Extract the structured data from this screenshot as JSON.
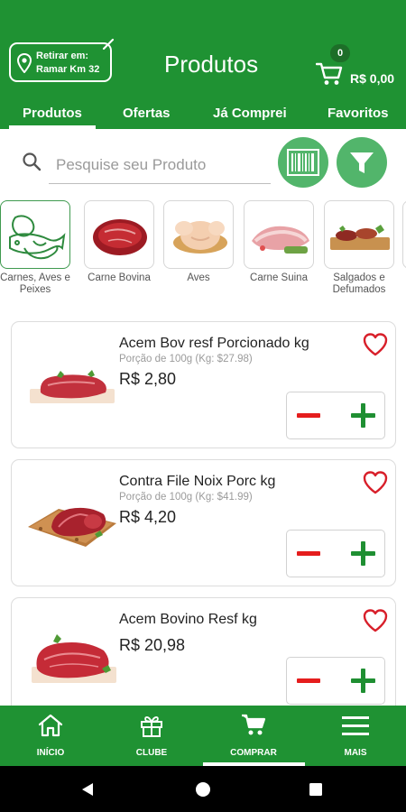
{
  "header": {
    "pickup_line1": "Retirar em:",
    "pickup_line2": "Ramar Km 32",
    "title": "Produtos",
    "cart_count": "0",
    "cart_total": "R$ 0,00"
  },
  "tabs": [
    {
      "label": "Produtos",
      "active": true
    },
    {
      "label": "Ofertas",
      "active": false
    },
    {
      "label": "Já Comprei",
      "active": false
    },
    {
      "label": "Favoritos",
      "active": false
    }
  ],
  "search": {
    "placeholder": "Pesquise seu Produto"
  },
  "categories": [
    {
      "label": "Carnes, Aves e Peixes",
      "selected": true
    },
    {
      "label": "Carne Bovina",
      "selected": false
    },
    {
      "label": "Aves",
      "selected": false
    },
    {
      "label": "Carne Suina",
      "selected": false
    },
    {
      "label": "Salgados e Defumados",
      "selected": false
    }
  ],
  "products": [
    {
      "name": "Acem Bov resf Porcionado kg",
      "portion": "Porção de 100g (Kg: $27.98)",
      "price": "R$ 2,80"
    },
    {
      "name": "Contra File Noix Porc kg",
      "portion": "Porção de 100g (Kg: $41.99)",
      "price": "R$ 4,20"
    },
    {
      "name": "Acem Bovino Resf kg",
      "portion": "",
      "price": "R$ 20,98"
    }
  ],
  "bottom_nav": [
    {
      "label": "INÍCIO",
      "icon": "home-icon"
    },
    {
      "label": "CLUBE",
      "icon": "gift-icon"
    },
    {
      "label": "COMPRAR",
      "icon": "cart-icon",
      "active": true
    },
    {
      "label": "MAIS",
      "icon": "menu-icon"
    }
  ],
  "colors": {
    "brand_green": "#1f9233",
    "button_green": "#52b56b",
    "minus_red": "#e51d1d",
    "plus_green": "#1f8f32",
    "heart_red": "#d81f2a"
  }
}
